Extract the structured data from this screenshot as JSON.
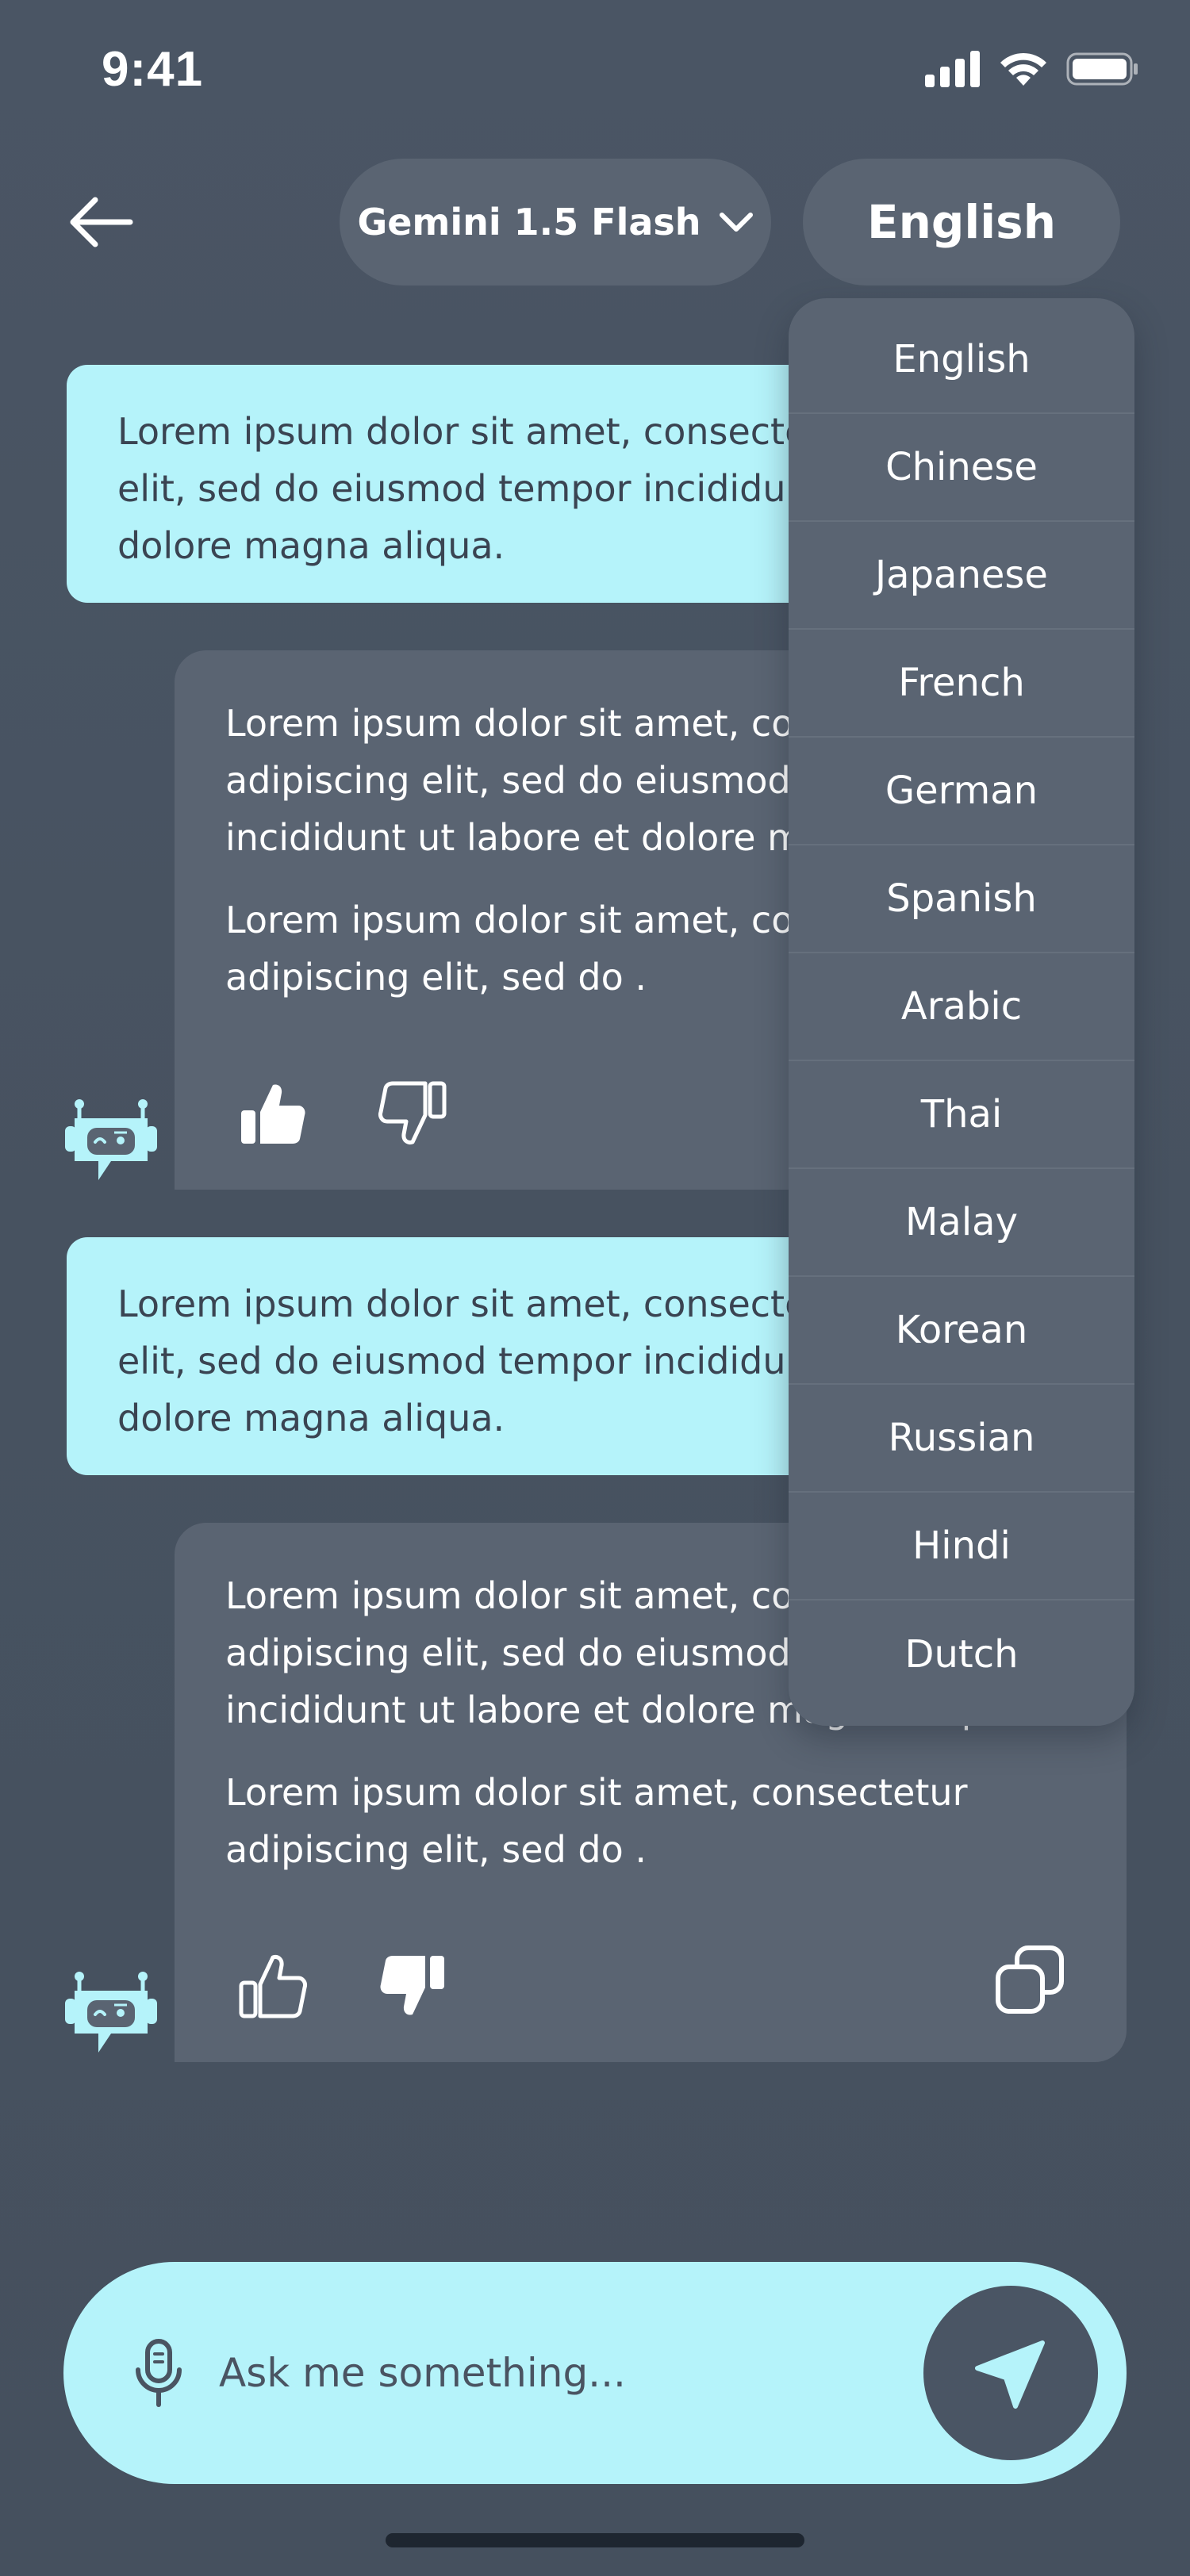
{
  "status_bar": {
    "time": "9:41"
  },
  "header": {
    "model_label": "Gemini 1.5 Flash",
    "language_label": "English"
  },
  "messages": [
    {
      "role": "user",
      "text": "Lorem ipsum dolor sit amet, consectetur adipiscing elit, sed do eiusmod tempor incididunt ut labore et dolore magna aliqua."
    },
    {
      "role": "bot",
      "paragraphs": [
        "Lorem ipsum dolor sit amet, consectetur adipiscing elit, sed do eiusmod tempor incididunt ut labore et dolore magna aliqua.",
        "Lorem ipsum dolor sit amet, consectetur adipiscing elit, sed do ."
      ],
      "feedback": "liked"
    },
    {
      "role": "user",
      "text": "Lorem ipsum dolor sit amet, consectetur adipiscing elit, sed do eiusmod tempor incididunt ut labore et dolore magna aliqua."
    },
    {
      "role": "bot",
      "paragraphs": [
        "Lorem ipsum dolor sit amet, consectetur adipiscing elit, sed do eiusmod tempor incididunt ut labore et dolore magna aliqua.",
        "Lorem ipsum dolor sit amet, consectetur adipiscing elit, sed do ."
      ],
      "feedback": "disliked"
    }
  ],
  "language_menu": {
    "options": [
      "English",
      "Chinese",
      "Japanese",
      "French",
      "German",
      "Spanish",
      "Arabic",
      "Thai",
      "Malay",
      "Korean",
      "Russian",
      "Hindi",
      "Dutch"
    ]
  },
  "input": {
    "placeholder": "Ask me something..."
  },
  "colors": {
    "background": "#4a5564",
    "surface": "#5a6472",
    "accent": "#b5f3fa",
    "text_dark": "#3a4452"
  },
  "icons": {
    "back": "arrow-left-icon",
    "model_chevron": "chevron-down-icon",
    "like": "thumbs-up-icon",
    "dislike": "thumbs-down-icon",
    "copy": "copy-icon",
    "avatar": "robot-icon",
    "mic": "microphone-icon",
    "send": "send-icon"
  }
}
